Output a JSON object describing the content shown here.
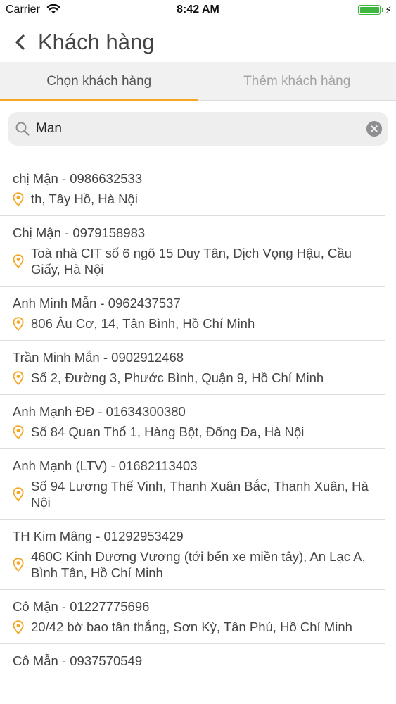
{
  "status_bar": {
    "carrier": "Carrier",
    "time": "8:42 AM"
  },
  "nav": {
    "title": "Khách hàng"
  },
  "tabs": [
    {
      "label": "Chọn khách hàng",
      "active": true
    },
    {
      "label": "Thêm khách hàng",
      "active": false
    }
  ],
  "search": {
    "value": "Man"
  },
  "customers": [
    {
      "name": "chị Mận - 0986632533",
      "address": "th, Tây Hồ, Hà Nội"
    },
    {
      "name": "Chị Mận - 0979158983",
      "address": "Toà nhà CIT số 6 ngõ 15 Duy Tân, Dịch Vọng Hậu, Cầu Giấy, Hà Nội"
    },
    {
      "name": "Anh Minh Mẫn - 0962437537",
      "address": "806 Âu Cơ, 14, Tân Bình, Hồ Chí Minh"
    },
    {
      "name": "Trần Minh Mẫn - 0902912468",
      "address": "Số 2, Đường 3, Phước Bình, Quận 9, Hồ Chí Minh"
    },
    {
      "name": "Anh Mạnh ĐĐ - 01634300380",
      "address": "Số 84 Quan Thổ 1, Hàng Bột, Đống Đa, Hà Nội"
    },
    {
      "name": "Anh Mạnh (LTV) - 01682113403",
      "address": "Số 94 Lương Thế Vinh, Thanh Xuân Bắc, Thanh Xuân, Hà Nội"
    },
    {
      "name": "TH Kim Mâng - 01292953429",
      "address": "460C Kinh Dương Vương (tới bến xe miền tây), An Lạc A, Bình Tân, Hồ Chí Minh"
    },
    {
      "name": "Cô Mận - 01227775696",
      "address": "20/42 bờ bao tân thắng, Sơn Kỳ, Tân Phú, Hồ Chí Minh"
    },
    {
      "name": "Cô Mẫn - 0937570549",
      "address": ""
    }
  ],
  "colors": {
    "accent": "#f5a623",
    "battery": "#3fb73f"
  }
}
